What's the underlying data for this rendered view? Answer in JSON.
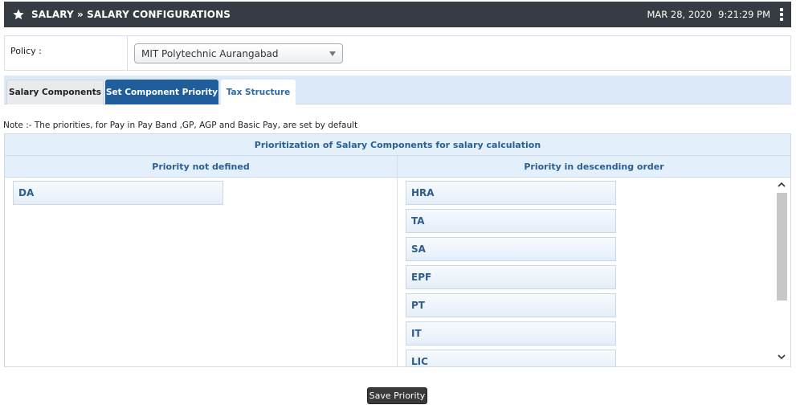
{
  "header": {
    "title": "SALARY » SALARY CONFIGURATIONS",
    "date": "MAR 28, 2020",
    "time": "9:21:29 PM",
    "colors": {
      "bar": "#373b44",
      "text": "#ffffff"
    }
  },
  "policy": {
    "label": "Policy :",
    "selected": "MIT Polytechnic Aurangabad"
  },
  "tabs": [
    {
      "label": "Salary Components",
      "active": false
    },
    {
      "label": "Set Component Priority",
      "active": true
    },
    {
      "label": "Tax Structure",
      "active": false
    }
  ],
  "note": "Note :- The priorities, for Pay in Pay Band ,GP, AGP and Basic Pay, are set by default",
  "panel": {
    "caption": "Prioritization of Salary Components for salary calculation",
    "left_header": "Priority not defined",
    "right_header": "Priority in descending order",
    "left_items": [
      "DA"
    ],
    "right_items": [
      "HRA",
      "TA",
      "SA",
      "EPF",
      "PT",
      "IT",
      "LIC"
    ]
  },
  "save_button": "Save Priority",
  "accent": {
    "tab_active_bg": "#1f5e9a",
    "link_blue": "#2d5d8c",
    "panel_bg": "#e3effb"
  }
}
